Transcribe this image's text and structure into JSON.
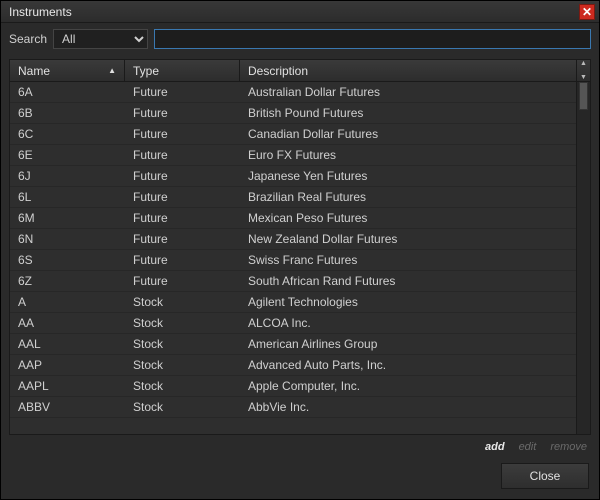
{
  "window": {
    "title": "Instruments"
  },
  "search": {
    "label": "Search",
    "filter_selected": "All",
    "input_value": ""
  },
  "columns": {
    "name": "Name",
    "type": "Type",
    "description": "Description"
  },
  "rows": [
    {
      "name": "6A",
      "type": "Future",
      "desc": "Australian Dollar Futures"
    },
    {
      "name": "6B",
      "type": "Future",
      "desc": "British Pound Futures"
    },
    {
      "name": "6C",
      "type": "Future",
      "desc": "Canadian Dollar Futures"
    },
    {
      "name": "6E",
      "type": "Future",
      "desc": "Euro FX Futures"
    },
    {
      "name": "6J",
      "type": "Future",
      "desc": "Japanese Yen Futures"
    },
    {
      "name": "6L",
      "type": "Future",
      "desc": "Brazilian Real Futures"
    },
    {
      "name": "6M",
      "type": "Future",
      "desc": "Mexican Peso Futures"
    },
    {
      "name": "6N",
      "type": "Future",
      "desc": "New Zealand Dollar Futures"
    },
    {
      "name": "6S",
      "type": "Future",
      "desc": "Swiss Franc Futures"
    },
    {
      "name": "6Z",
      "type": "Future",
      "desc": "South African Rand Futures"
    },
    {
      "name": "A",
      "type": "Stock",
      "desc": "Agilent Technologies"
    },
    {
      "name": "AA",
      "type": "Stock",
      "desc": "ALCOA Inc."
    },
    {
      "name": "AAL",
      "type": "Stock",
      "desc": "American Airlines Group"
    },
    {
      "name": "AAP",
      "type": "Stock",
      "desc": "Advanced Auto Parts, Inc."
    },
    {
      "name": "AAPL",
      "type": "Stock",
      "desc": "Apple Computer, Inc."
    },
    {
      "name": "ABBV",
      "type": "Stock",
      "desc": "AbbVie Inc."
    }
  ],
  "actions": {
    "add": "add",
    "edit": "edit",
    "remove": "remove"
  },
  "footer": {
    "close": "Close"
  }
}
